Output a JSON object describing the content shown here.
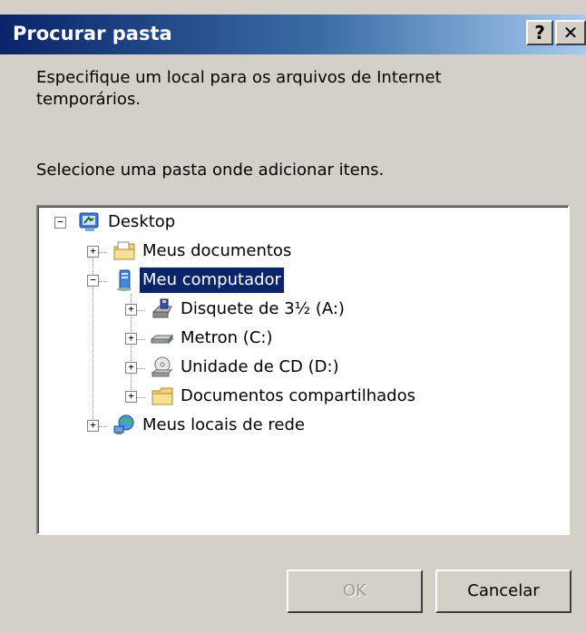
{
  "dialog": {
    "title": "Procurar pasta",
    "help_glyph": "?",
    "close_glyph": "✕",
    "description": "Especifique um local para os arquivos de Internet temporários.",
    "instruction": "Selecione uma pasta onde adicionar itens."
  },
  "tree": {
    "expanded_glyph": "−",
    "collapsed_glyph": "+",
    "items": [
      {
        "label": "Desktop",
        "icon": "desktop-icon",
        "state": "expanded"
      },
      {
        "label": "Meus documentos",
        "icon": "my-documents-icon",
        "state": "collapsed"
      },
      {
        "label": "Meu computador",
        "icon": "my-computer-icon",
        "state": "expanded",
        "selected": true
      },
      {
        "label": "Disquete de 3½ (A:)",
        "icon": "floppy-drive-icon",
        "state": "collapsed"
      },
      {
        "label": "Metron (C:)",
        "icon": "hard-drive-icon",
        "state": "collapsed"
      },
      {
        "label": "Unidade de CD (D:)",
        "icon": "cd-drive-icon",
        "state": "collapsed"
      },
      {
        "label": "Documentos compartilhados",
        "icon": "shared-folder-icon",
        "state": "collapsed"
      },
      {
        "label": "Meus locais de rede",
        "icon": "network-places-icon",
        "state": "collapsed"
      }
    ]
  },
  "buttons": {
    "ok_label": "OK",
    "ok_enabled": false,
    "cancel_label": "Cancelar"
  }
}
